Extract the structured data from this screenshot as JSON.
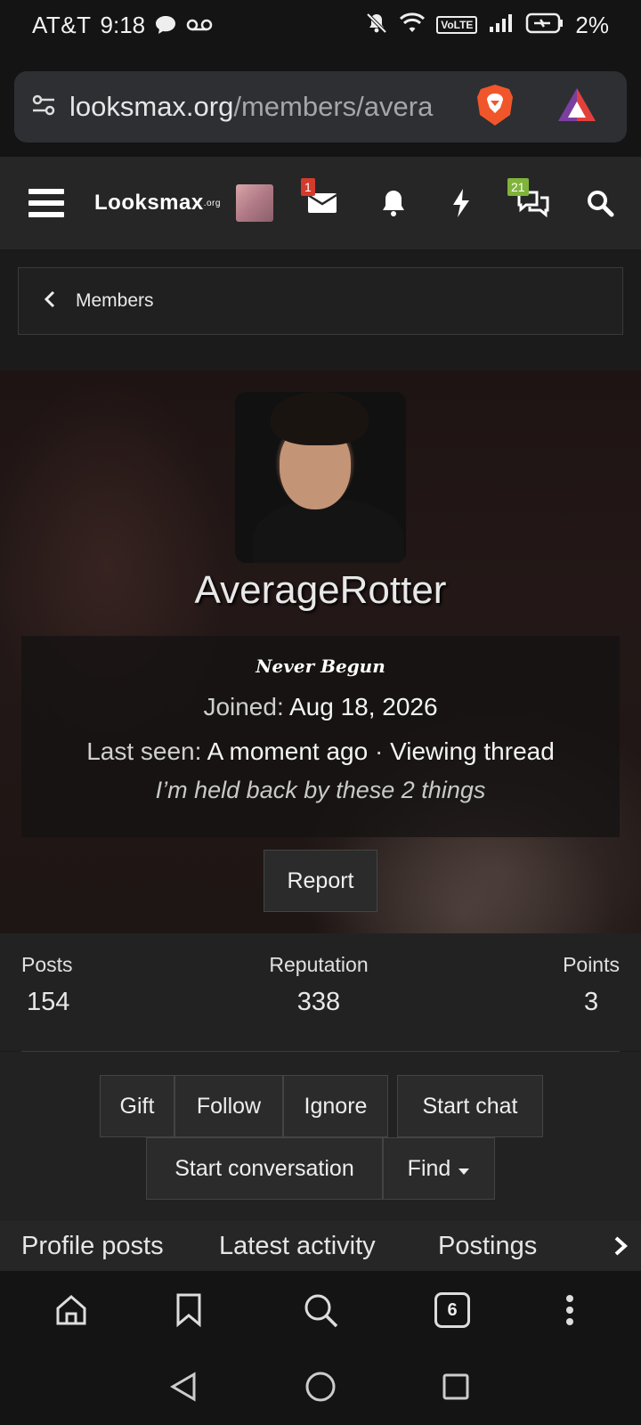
{
  "status_bar": {
    "carrier": "AT&T",
    "time": "9:18",
    "volte": "VoLTE",
    "battery": "2%"
  },
  "browser": {
    "url_host": "looksmax.org",
    "url_path": "/members/avera"
  },
  "site_header": {
    "logo": "Looksmax",
    "logo_suffix": ".org",
    "messages_badge": "1",
    "chat_badge": "21"
  },
  "breadcrumb": {
    "label": "Members"
  },
  "profile": {
    "username": "AverageRotter",
    "title": "Never Begun",
    "joined_label": "Joined:",
    "joined_value": "Aug 18, 2026",
    "last_seen_label": "Last seen:",
    "last_seen_value": "A moment ago",
    "separator": "·",
    "activity": "Viewing thread",
    "thread_title": "I’m held back by these 2 things",
    "report_label": "Report"
  },
  "stats": {
    "posts_label": "Posts",
    "posts_value": "154",
    "reputation_label": "Reputation",
    "reputation_value": "338",
    "points_label": "Points",
    "points_value": "3"
  },
  "actions": {
    "gift": "Gift",
    "follow": "Follow",
    "ignore": "Ignore",
    "start_chat": "Start chat",
    "start_conversation": "Start conversation",
    "find": "Find"
  },
  "tabs": [
    "Profile posts",
    "Latest activity",
    "Postings"
  ],
  "bottom_bar": {
    "tabs_count": "6"
  },
  "colors": {
    "badge_red": "#d33b2c",
    "badge_green": "#7fb33a",
    "brave_orange": "#f1562b"
  }
}
